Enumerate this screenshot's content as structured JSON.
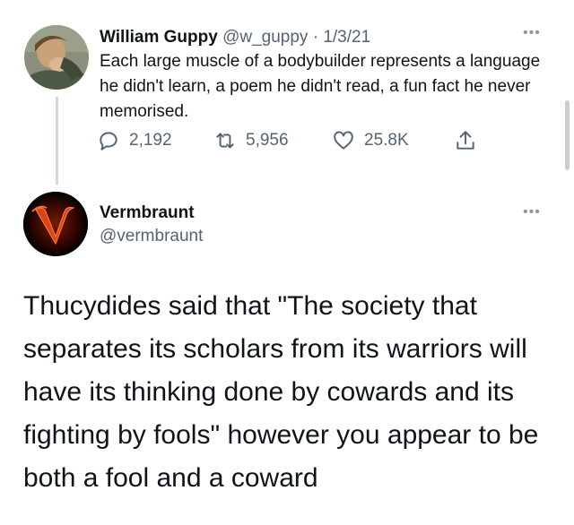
{
  "tweet1": {
    "name": "William Guppy",
    "handle": "@w_guppy",
    "separator": "·",
    "date": "1/3/21",
    "more_icon": "more-dots-icon",
    "text": "Each large muscle of a bodybuilder represents a language he didn't learn, a poem he didn't read, a fun fact he never memorised.",
    "actions": {
      "reply_count": "2,192",
      "retweet_count": "5,956",
      "like_count": "25.8K"
    }
  },
  "tweet2": {
    "name": "Vermbraunt",
    "handle": "@vermbraunt",
    "more_icon": "more-dots-icon",
    "text": "Thucydides said that \"The society that separates its scholars from its warriors will have its thinking done by cowards and its fighting by fools\" however you appear to be both a fool and a coward"
  },
  "colors": {
    "text": "#0f1419",
    "muted": "#536471",
    "thread_line": "#cfd9de"
  }
}
